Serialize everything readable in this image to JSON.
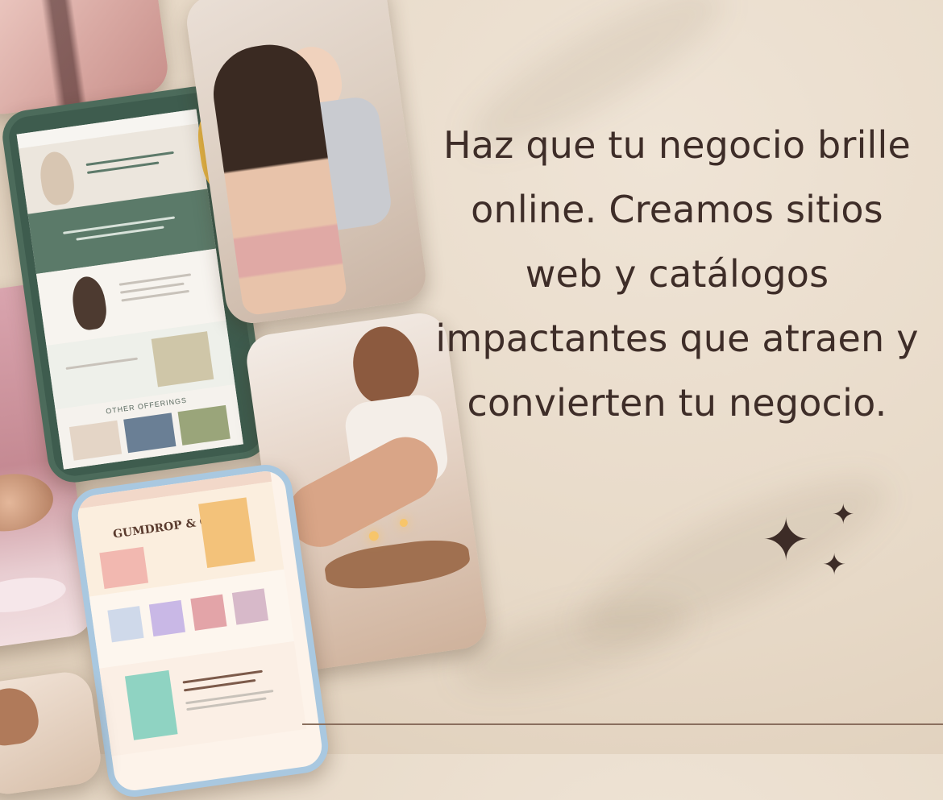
{
  "headline": "Haz que tu negocio brille online. Creamos sitios web y catálogos impactantes que atraen y convierten tu negocio.",
  "mockups": {
    "green_site": {
      "offerings_label": "OTHER OFFERINGS"
    },
    "blue_site": {
      "brand": "GUMDROP & CO."
    }
  },
  "icons": [
    "sparkle-icon-large",
    "sparkle-icon-small-top",
    "sparkle-icon-small-bottom"
  ],
  "colors": {
    "background": "#e9dccb",
    "text": "#3e2d28",
    "green_mockup": "#3e5c4e",
    "blue_mockup": "#a9c8e0"
  }
}
